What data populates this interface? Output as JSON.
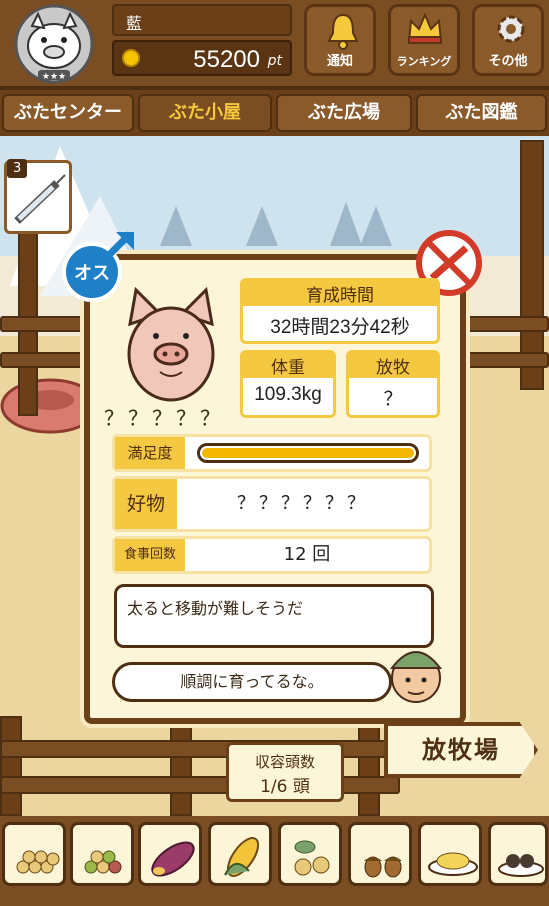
{
  "header": {
    "player_name": "藍",
    "points": "55200",
    "points_unit": "pt",
    "buttons": [
      {
        "label": "通知",
        "icon": "bell-icon"
      },
      {
        "label": "ランキング",
        "icon": "crown-icon"
      },
      {
        "label": "その他",
        "icon": "gear-icon"
      }
    ]
  },
  "tabs": [
    {
      "label": "ぶたセンター",
      "active": false
    },
    {
      "label": "ぶた小屋",
      "active": true
    },
    {
      "label": "ぶた広場",
      "active": false
    },
    {
      "label": "ぶた図鑑",
      "active": false
    }
  ],
  "inject_count": "3",
  "pig": {
    "gender_badge": "オス",
    "name": "？？？？？",
    "growth_time_label": "育成時間",
    "growth_time": "32時間23分42秒",
    "weight_label": "体重",
    "weight": "109.3kg",
    "pasture_label": "放牧",
    "pasture": "？",
    "satisfaction_label": "満足度",
    "satisfaction": 1.0,
    "favorite_label": "好物",
    "favorite": "？？？？？？",
    "meals_label": "食事回数",
    "meals": "12 回"
  },
  "speech": "太ると移動が難しそうだ",
  "comment": "順調に育ってるな。",
  "capacity": {
    "label": "収容頭数",
    "value": "1/6 頭"
  },
  "ranch_sign": "放牧場",
  "feeds": [
    "soybeans-icon",
    "mixed-beans-icon",
    "sweet-potato-icon",
    "corn-icon",
    "chestnuts-icon",
    "acorns-icon",
    "rice-bowl-icon",
    "berries-plate-icon"
  ]
}
